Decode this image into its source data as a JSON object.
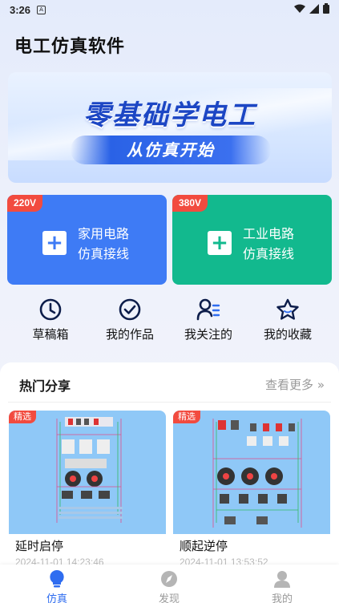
{
  "status_bar": {
    "time": "3:26"
  },
  "app": {
    "title": "电工仿真软件"
  },
  "banner": {
    "headline": "零基础学电工",
    "subline": "从仿真开始"
  },
  "circuit_cards": [
    {
      "voltage": "220V",
      "line1": "家用电路",
      "line2": "仿真接线",
      "color": "#3e7bf5"
    },
    {
      "voltage": "380V",
      "line1": "工业电路",
      "line2": "仿真接线",
      "color": "#12b98e"
    }
  ],
  "quick_actions": [
    {
      "label": "草稿箱",
      "icon": "clock-icon"
    },
    {
      "label": "我的作品",
      "icon": "check-circle-icon"
    },
    {
      "label": "我关注的",
      "icon": "user-list-icon"
    },
    {
      "label": "我的收藏",
      "icon": "star-icon"
    }
  ],
  "share": {
    "title": "热门分享",
    "see_more": "查看更多",
    "posts": [
      {
        "tag": "精选",
        "title": "延时启停",
        "date": "2024-11-01 14:23:46"
      },
      {
        "tag": "精选",
        "title": "顺起逆停",
        "date": "2024-11-01 13:53:52"
      }
    ]
  },
  "nav": {
    "items": [
      {
        "label": "仿真",
        "icon": "bulb-icon",
        "active": true
      },
      {
        "label": "发现",
        "icon": "compass-icon",
        "active": false
      },
      {
        "label": "我的",
        "icon": "person-icon",
        "active": false
      }
    ]
  },
  "colors": {
    "accent": "#2f6df0",
    "home": "#3e7bf5",
    "industrial": "#12b98e",
    "tag": "#f24b3f"
  }
}
